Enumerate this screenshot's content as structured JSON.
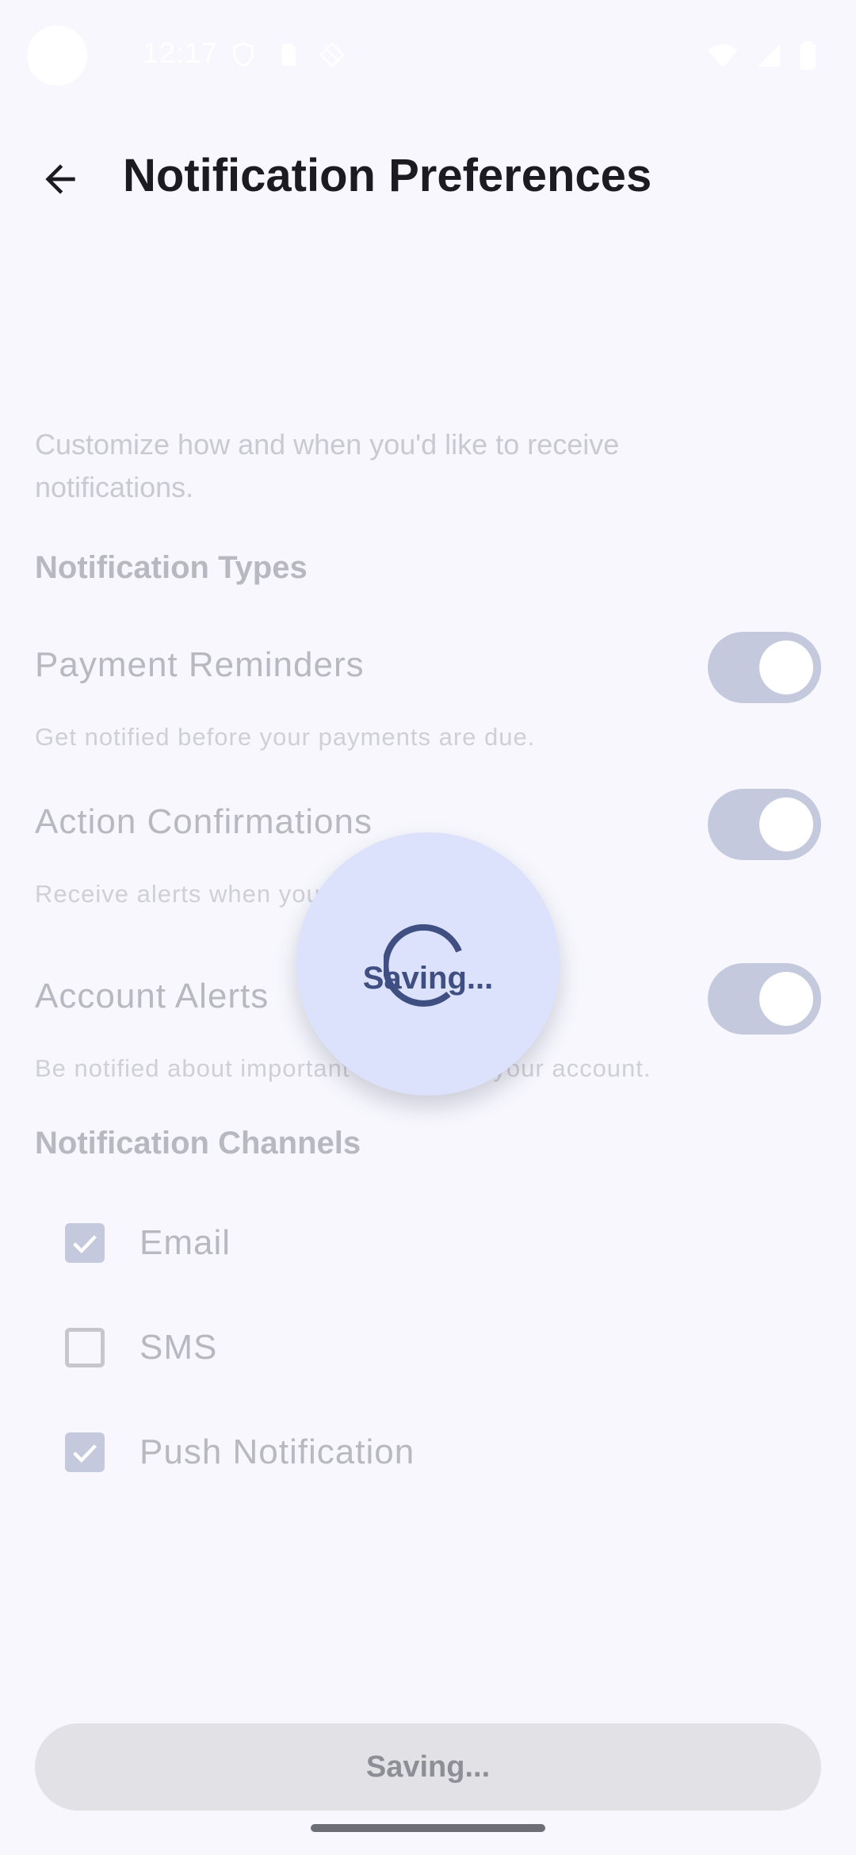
{
  "status_bar": {
    "time": "12:17"
  },
  "header": {
    "title": "Notification Preferences"
  },
  "intro_text": "Customize how and when you'd like to receive notifications.",
  "notification_types": {
    "heading": "Notification Types",
    "items": [
      {
        "title": "Payment Reminders",
        "description": "Get notified before your payments are due.",
        "enabled": true
      },
      {
        "title": "Action Confirmations",
        "description": "Receive alerts when you make a payment.",
        "enabled": true
      },
      {
        "title": "Account Alerts",
        "description": "Be notified about important changes to your account.",
        "enabled": true
      }
    ]
  },
  "notification_channels": {
    "heading": "Notification Channels",
    "items": [
      {
        "label": "Email",
        "checked": true
      },
      {
        "label": "SMS",
        "checked": false
      },
      {
        "label": "Push Notification",
        "checked": true
      }
    ]
  },
  "save_button": {
    "label": "Saving..."
  },
  "loading_overlay": {
    "label": "Saving..."
  },
  "colors": {
    "accent": "#3f4f82",
    "toggle_track": "#c5c9dd",
    "overlay_bg": "#dce2fb",
    "background": "#f7f7fd"
  }
}
